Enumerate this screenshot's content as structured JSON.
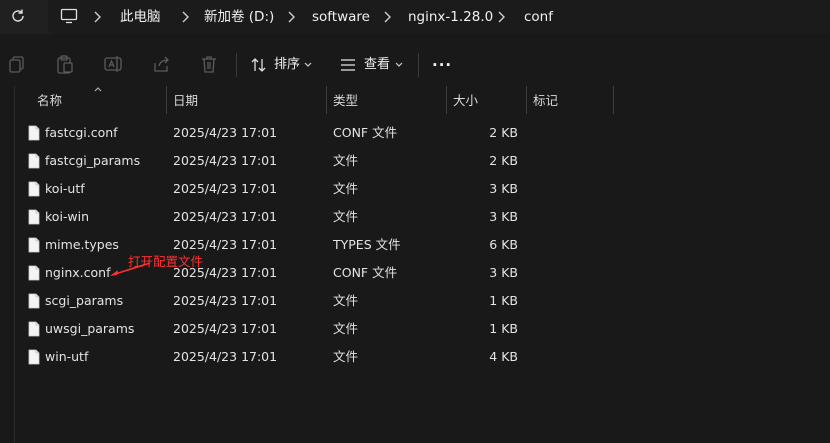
{
  "breadcrumb": {
    "items": [
      "此电脑",
      "新加卷 (D:)",
      "software",
      "nginx-1.28.0",
      "conf"
    ]
  },
  "toolbar": {
    "sort_label": "排序",
    "view_label": "查看",
    "more_label": "···"
  },
  "columns": {
    "name": "名称",
    "date": "日期",
    "type": "类型",
    "size": "大小",
    "tag": "标记"
  },
  "files": [
    {
      "name": "fastcgi.conf",
      "date": "2025/4/23 17:01",
      "type": "CONF 文件",
      "size": "2 KB"
    },
    {
      "name": "fastcgi_params",
      "date": "2025/4/23 17:01",
      "type": "文件",
      "size": "2 KB"
    },
    {
      "name": "koi-utf",
      "date": "2025/4/23 17:01",
      "type": "文件",
      "size": "3 KB"
    },
    {
      "name": "koi-win",
      "date": "2025/4/23 17:01",
      "type": "文件",
      "size": "3 KB"
    },
    {
      "name": "mime.types",
      "date": "2025/4/23 17:01",
      "type": "TYPES 文件",
      "size": "6 KB"
    },
    {
      "name": "nginx.conf",
      "date": "2025/4/23 17:01",
      "type": "CONF 文件",
      "size": "3 KB"
    },
    {
      "name": "scgi_params",
      "date": "2025/4/23 17:01",
      "type": "文件",
      "size": "1 KB"
    },
    {
      "name": "uwsgi_params",
      "date": "2025/4/23 17:01",
      "type": "文件",
      "size": "1 KB"
    },
    {
      "name": "win-utf",
      "date": "2025/4/23 17:01",
      "type": "文件",
      "size": "4 KB"
    }
  ],
  "annotation": {
    "text": "打开配置文件",
    "color": "#ff3030"
  },
  "icons": {
    "refresh": "refresh-icon",
    "computer": "computer-icon",
    "copy": "copy-icon",
    "paste": "paste-icon",
    "rename": "rename-icon",
    "share": "share-icon",
    "delete": "delete-icon",
    "sort": "sort-icon",
    "view": "view-icon"
  }
}
